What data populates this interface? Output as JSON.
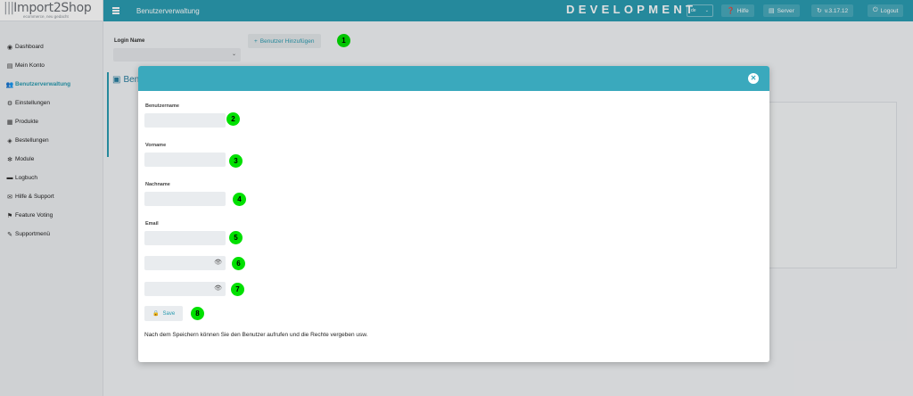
{
  "app": {
    "logo_main": "Import2Shop",
    "logo_sub": "ecommerce, neu gedacht"
  },
  "topbar": {
    "page_title": "Benutzerverwaltung",
    "environment": "DEVELOPMENT",
    "language": "de",
    "help_label": "Hilfe",
    "server_label": "Server",
    "version_label": "v.3.17.12",
    "logout_label": "Logout"
  },
  "sidebar": {
    "items": [
      {
        "label": "Dashboard",
        "icon": "dashboard-icon",
        "glyph": "◉"
      },
      {
        "label": "Mein Konto",
        "icon": "user-icon",
        "glyph": "▤"
      },
      {
        "label": "Benutzerverwaltung",
        "icon": "users-icon",
        "glyph": "👥",
        "active": true
      },
      {
        "label": "Einstellungen",
        "icon": "gears-icon",
        "glyph": "⚙"
      },
      {
        "label": "Produkte",
        "icon": "products-icon",
        "glyph": "▦"
      },
      {
        "label": "Bestellungen",
        "icon": "orders-icon",
        "glyph": "◈"
      },
      {
        "label": "Module",
        "icon": "modules-icon",
        "glyph": "✻"
      },
      {
        "label": "Logbuch",
        "icon": "logbook-icon",
        "glyph": "▬"
      },
      {
        "label": "Hilfe & Support",
        "icon": "support-icon",
        "glyph": "✉"
      },
      {
        "label": "Feature Voting",
        "icon": "voting-icon",
        "glyph": "⚑"
      },
      {
        "label": "Supportmenü",
        "icon": "wrench-icon",
        "glyph": "✎"
      }
    ]
  },
  "main": {
    "login_label": "Login Name",
    "add_user_label": "Benutzer Hinzufügen",
    "panel_title": "Ben"
  },
  "modal": {
    "fields": [
      {
        "label": "Benutzername",
        "value": "",
        "marker": "2"
      },
      {
        "label": "Vorname",
        "value": "",
        "marker": "3"
      },
      {
        "label": "Nachname",
        "value": "",
        "marker": "4"
      },
      {
        "label": "Email",
        "value": "",
        "marker": "5"
      }
    ],
    "password_marker": "6",
    "password_repeat_marker": "7",
    "save_label": "Save",
    "save_marker": "8",
    "note": "Nach dem Speichern können Sie den Benutzer aufrufen und die Rechte vergeben usw."
  },
  "markers": {
    "add_user": "1"
  },
  "colors": {
    "accent": "#2b9cb2",
    "modal_header": "#3aa9bd",
    "marker": "#00e000"
  }
}
